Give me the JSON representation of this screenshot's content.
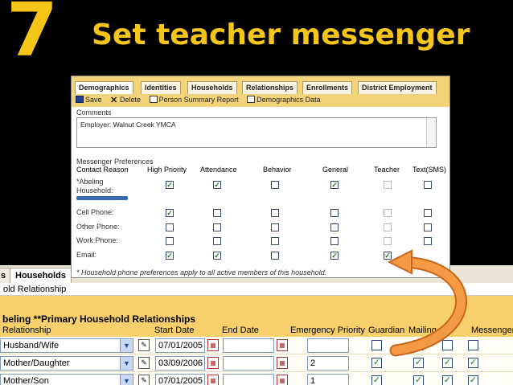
{
  "slide": {
    "number": "7",
    "title": "Set teacher messenger"
  },
  "colors": {
    "title": "#f5c518",
    "tab_bar": "#f3d37a",
    "arrow": "#ef8e38"
  },
  "back_screen": {
    "tabs": [
      "s",
      "Households"
    ],
    "subtitle": "old Relationship",
    "section": "beling **Primary Household Relationships",
    "columns": [
      "Relationship",
      "Start Date",
      "End Date",
      "Emergency Priority",
      "Guardian",
      "Mailing",
      "Messenger"
    ],
    "rows": [
      {
        "relationship": "Husband/Wife",
        "start": "07/01/2005",
        "end": "",
        "priority": "",
        "guardian": false,
        "mailing": false,
        "mail2": false,
        "messenger": false
      },
      {
        "relationship": "Mother/Daughter",
        "start": "03/09/2006",
        "end": "",
        "priority": "2",
        "guardian": true,
        "mailing": true,
        "mail2": true,
        "messenger": true
      },
      {
        "relationship": "Mother/Son",
        "start": "07/01/2005",
        "end": "",
        "priority": "1",
        "guardian": true,
        "mailing": true,
        "mail2": true,
        "messenger": true
      }
    ]
  },
  "panel": {
    "tabs": [
      "Demographics",
      "Identities",
      "Households",
      "Relationships",
      "Enrollments",
      "District Employment"
    ],
    "toolbar": {
      "save": "Save",
      "delete": "Delete",
      "summary": "Person Summary Report",
      "demo": "Demographics Data"
    },
    "comments_label": "Comments",
    "comments_value": "Employer: Walnut Creek YMCA",
    "messenger_title": "Messenger Preferences",
    "headers": [
      "Contact Reason",
      "High Priority",
      "Attendance",
      "Behavior",
      "General",
      "Teacher",
      "Text(SMS)"
    ],
    "household_label_1": "*Abeling",
    "household_label_2": "Household:",
    "rows": [
      {
        "label": "",
        "checks": [
          true,
          true,
          false,
          true,
          false,
          false
        ]
      },
      {
        "label": "Cell Phone:",
        "checks": [
          true,
          false,
          false,
          false,
          false,
          false
        ]
      },
      {
        "label": "Other Phone:",
        "checks": [
          false,
          false,
          false,
          false,
          false,
          false
        ]
      },
      {
        "label": "Work Phone:",
        "checks": [
          false,
          false,
          false,
          false,
          false,
          false
        ]
      },
      {
        "label": "Email:",
        "checks": [
          true,
          true,
          false,
          true,
          true,
          null
        ]
      }
    ],
    "footnote": "* Household phone preferences apply to all active members of this household."
  }
}
